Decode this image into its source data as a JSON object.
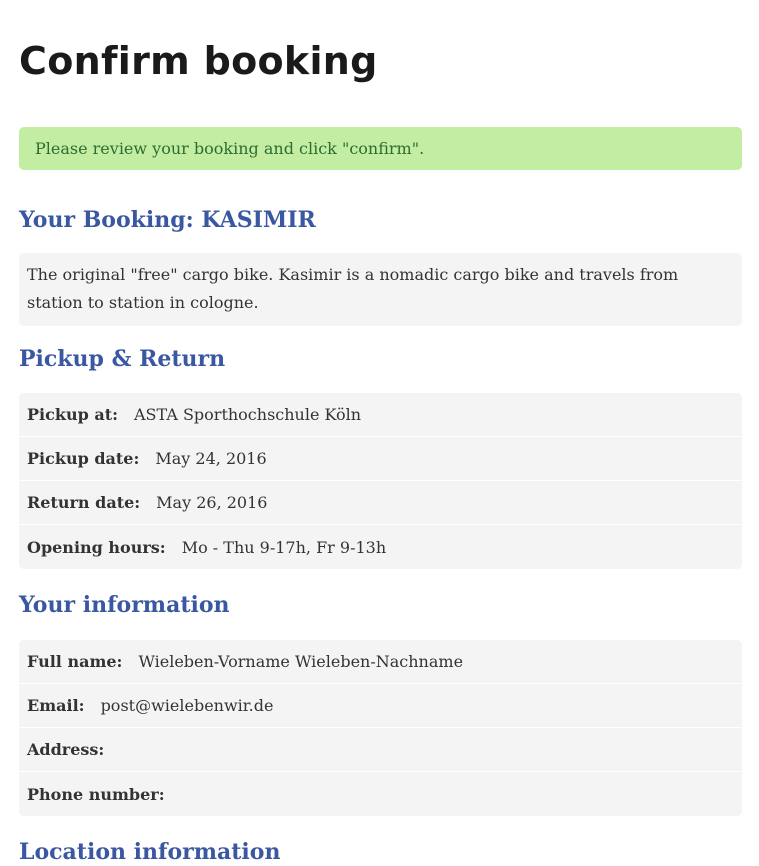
{
  "page": {
    "title": "Confirm booking"
  },
  "notice": {
    "text": "Please review your booking and click \"confirm\"."
  },
  "booking": {
    "heading": "Your Booking: KASIMIR",
    "description": "The original \"free\" cargo bike. Kasimir is a nomadic cargo bike and travels from station to station in cologne."
  },
  "pickup_return": {
    "heading": "Pickup & Return",
    "rows": [
      {
        "label": "Pickup at:",
        "value": "ASTA Sporthochschule Köln"
      },
      {
        "label": "Pickup date:",
        "value": "May 24, 2016"
      },
      {
        "label": "Return date:",
        "value": "May 26, 2016"
      },
      {
        "label": "Opening hours:",
        "value": "Mo - Thu 9-17h, Fr 9-13h"
      }
    ]
  },
  "your_information": {
    "heading": "Your information",
    "rows": [
      {
        "label": "Full name:",
        "value": "Wieleben-Vorname Wieleben-Nachname"
      },
      {
        "label": "Email:",
        "value": "post@wielebenwir.de"
      },
      {
        "label": "Address:",
        "value": ""
      },
      {
        "label": "Phone number:",
        "value": ""
      }
    ]
  },
  "location_information": {
    "heading": "Location information"
  },
  "colors": {
    "heading_blue": "#3a58a1",
    "notice_background": "#c2eda3",
    "notice_text": "#2e6d2f",
    "box_background": "#f4f4f4"
  }
}
